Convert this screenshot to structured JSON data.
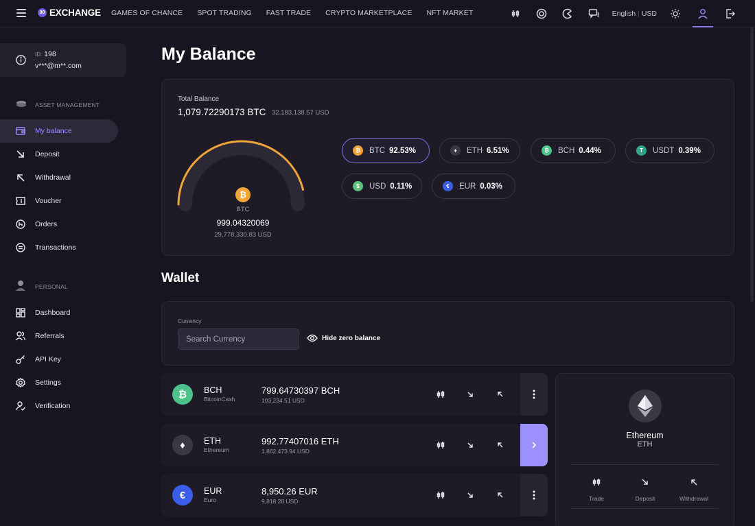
{
  "header": {
    "logo_text": "EXCHANGE",
    "nav": [
      "GAMES OF CHANCE",
      "SPOT TRADING",
      "FAST TRADE",
      "CRYPTO MARKETPLACE",
      "NFT MARKET"
    ],
    "language": "English",
    "currency": "USD"
  },
  "sidebar": {
    "id_label": "ID:",
    "id_value": "198",
    "email": "v***@m**.com",
    "section_asset": "ASSET MANAGEMENT",
    "asset_items": [
      "My balance",
      "Deposit",
      "Withdrawal",
      "Voucher",
      "Orders",
      "Transactions"
    ],
    "section_personal": "PERSONAL",
    "personal_items": [
      "Dashboard",
      "Referrals",
      "API Key",
      "Settings",
      "Verification"
    ]
  },
  "main": {
    "title": "My Balance",
    "total_label": "Total Balance",
    "total_btc": "1,079.72290173 BTC",
    "total_usd": "32,183,138.57 USD",
    "gauge": {
      "percent": 92.53,
      "coin": "BTC",
      "amount": "999.04320069",
      "usd": "29,778,330.83 USD"
    },
    "allocation": [
      {
        "name": "BTC",
        "pct": "92.53%",
        "color": "#f0a43a",
        "glyph": "₿"
      },
      {
        "name": "ETH",
        "pct": "6.51%",
        "color": "#3a3845",
        "glyph": "♦"
      },
      {
        "name": "BCH",
        "pct": "0.44%",
        "color": "#4cc38a",
        "glyph": "₿"
      },
      {
        "name": "USDT",
        "pct": "0.39%",
        "color": "#2fa588",
        "glyph": "T"
      },
      {
        "name": "USD",
        "pct": "0.11%",
        "color": "#5ec27b",
        "glyph": "$"
      },
      {
        "name": "EUR",
        "pct": "0.03%",
        "color": "#3b5de7",
        "glyph": "€"
      }
    ],
    "wallet_title": "Wallet",
    "currency_label": "Currency",
    "search_placeholder": "Search Currency",
    "hide_zero": "Hide zero balance"
  },
  "wallet_rows": [
    {
      "symbol": "BCH",
      "name": "BitcoinCash",
      "amount": "799.64730397 BCH",
      "usd": "103,234.51 USD",
      "color": "#4cc38a",
      "glyph": "₿"
    },
    {
      "symbol": "ETH",
      "name": "Ethereum",
      "amount": "992.77407016 ETH",
      "usd": "1,862,473.94 USD",
      "color": "#3a3845",
      "glyph": "♦"
    },
    {
      "symbol": "EUR",
      "name": "Euro",
      "amount": "8,950.26 EUR",
      "usd": "9,818.28 USD",
      "color": "#3b5de7",
      "glyph": "€"
    }
  ],
  "detail": {
    "name": "Ethereum",
    "symbol": "ETH",
    "actions": [
      "Trade",
      "Deposit",
      "Withdrawal"
    ]
  },
  "colors": {
    "accent": "#9c8fff",
    "gauge": "#f0a43a"
  }
}
